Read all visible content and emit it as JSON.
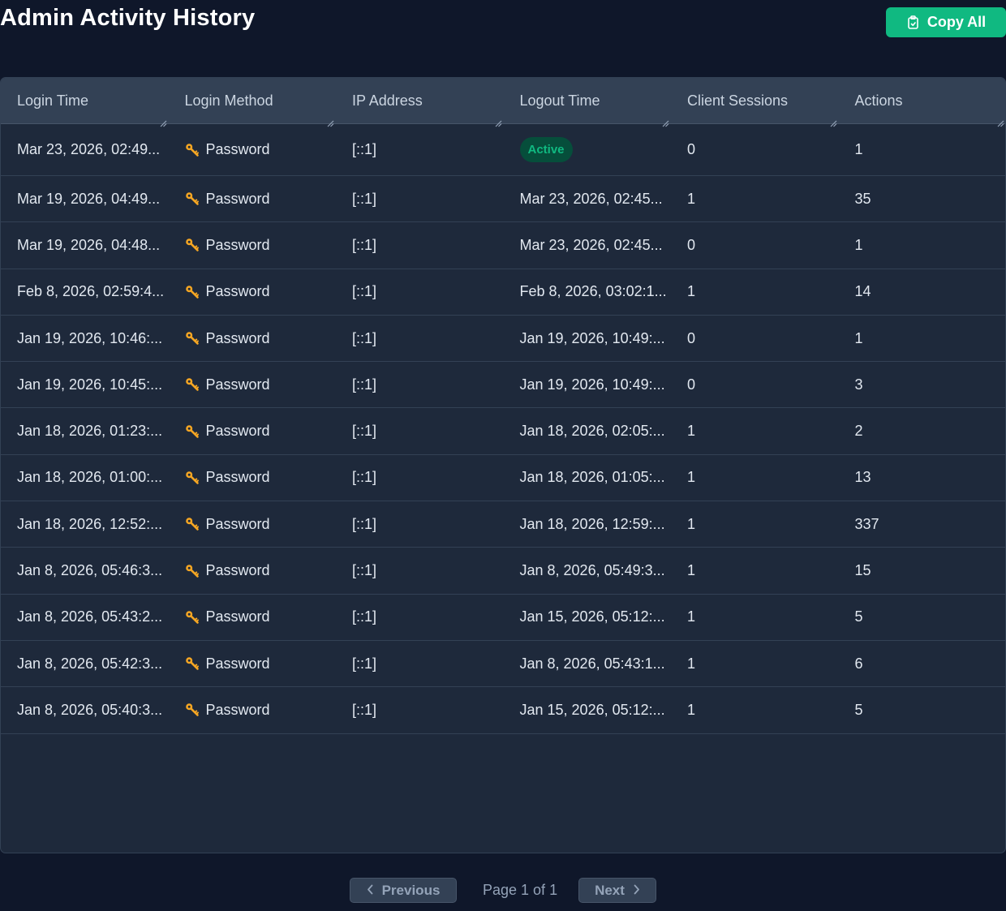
{
  "page": {
    "title": "Admin Activity History",
    "copy_all_label": "Copy All"
  },
  "table": {
    "headers": [
      "Login Time",
      "Login Method",
      "IP Address",
      "Logout Time",
      "Client Sessions",
      "Actions"
    ],
    "rows": [
      {
        "login": "Mar 23, 2026, 02:49...",
        "method": "Password",
        "ip": "[::1]",
        "logout": "",
        "status": "Active",
        "sessions": "0",
        "actions": "1"
      },
      {
        "login": "Mar 19, 2026, 04:49...",
        "method": "Password",
        "ip": "[::1]",
        "logout": "Mar 23, 2026, 02:45...",
        "sessions": "1",
        "actions": "35"
      },
      {
        "login": "Mar 19, 2026, 04:48...",
        "method": "Password",
        "ip": "[::1]",
        "logout": "Mar 23, 2026, 02:45...",
        "sessions": "0",
        "actions": "1"
      },
      {
        "login": "Feb 8, 2026, 02:59:4...",
        "method": "Password",
        "ip": "[::1]",
        "logout": "Feb 8, 2026, 03:02:1...",
        "sessions": "1",
        "actions": "14"
      },
      {
        "login": "Jan 19, 2026, 10:46:...",
        "method": "Password",
        "ip": "[::1]",
        "logout": "Jan 19, 2026, 10:49:...",
        "sessions": "0",
        "actions": "1"
      },
      {
        "login": "Jan 19, 2026, 10:45:...",
        "method": "Password",
        "ip": "[::1]",
        "logout": "Jan 19, 2026, 10:49:...",
        "sessions": "0",
        "actions": "3"
      },
      {
        "login": "Jan 18, 2026, 01:23:...",
        "method": "Password",
        "ip": "[::1]",
        "logout": "Jan 18, 2026, 02:05:...",
        "sessions": "1",
        "actions": "2"
      },
      {
        "login": "Jan 18, 2026, 01:00:...",
        "method": "Password",
        "ip": "[::1]",
        "logout": "Jan 18, 2026, 01:05:...",
        "sessions": "1",
        "actions": "13"
      },
      {
        "login": "Jan 18, 2026, 12:52:...",
        "method": "Password",
        "ip": "[::1]",
        "logout": "Jan 18, 2026, 12:59:...",
        "sessions": "1",
        "actions": "337"
      },
      {
        "login": "Jan 8, 2026, 05:46:3...",
        "method": "Password",
        "ip": "[::1]",
        "logout": "Jan 8, 2026, 05:49:3...",
        "sessions": "1",
        "actions": "15"
      },
      {
        "login": "Jan 8, 2026, 05:43:2...",
        "method": "Password",
        "ip": "[::1]",
        "logout": "Jan 15, 2026, 05:12:...",
        "sessions": "1",
        "actions": "5"
      },
      {
        "login": "Jan 8, 2026, 05:42:3...",
        "method": "Password",
        "ip": "[::1]",
        "logout": "Jan 8, 2026, 05:43:1...",
        "sessions": "1",
        "actions": "6"
      },
      {
        "login": "Jan 8, 2026, 05:40:3...",
        "method": "Password",
        "ip": "[::1]",
        "logout": "Jan 15, 2026, 05:12:...",
        "sessions": "1",
        "actions": "5"
      }
    ]
  },
  "pagination": {
    "previous_label": "Previous",
    "next_label": "Next",
    "page_text": "Page 1 of 1"
  },
  "colors": {
    "background": "#0f172a",
    "panel": "#1e293b",
    "header": "#334155",
    "accent": "#10b981",
    "key_icon": "#f5a623"
  },
  "icons": {
    "copy_button": "clipboard-icon",
    "login_method": "key-icon",
    "previous": "chevron-left-icon",
    "next": "chevron-right-icon",
    "column_resize": "resize-handle-icon"
  }
}
